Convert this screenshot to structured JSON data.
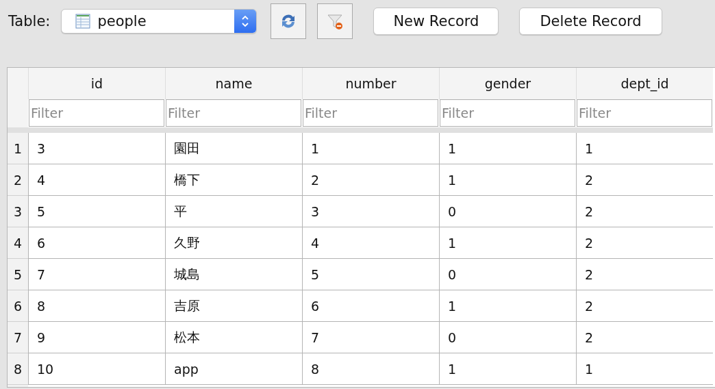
{
  "toolbar": {
    "label": "Table:",
    "table_select": {
      "value": "people"
    },
    "buttons": [
      "New Record",
      "Delete Record"
    ]
  },
  "table": {
    "columns": [
      {
        "header": "id",
        "filter_placeholder": "Filter"
      },
      {
        "header": "name",
        "filter_placeholder": "Filter"
      },
      {
        "header": "number",
        "filter_placeholder": "Filter"
      },
      {
        "header": "gender",
        "filter_placeholder": "Filter"
      },
      {
        "header": "dept_id",
        "filter_placeholder": "Filter"
      }
    ],
    "rows": [
      {
        "row_number": "1",
        "cells": [
          "3",
          "園田",
          "1",
          "1",
          "1"
        ]
      },
      {
        "row_number": "2",
        "cells": [
          "4",
          "橋下",
          "2",
          "1",
          "2"
        ]
      },
      {
        "row_number": "3",
        "cells": [
          "5",
          "平",
          "3",
          "0",
          "2"
        ]
      },
      {
        "row_number": "4",
        "cells": [
          "6",
          "久野",
          "4",
          "1",
          "2"
        ]
      },
      {
        "row_number": "5",
        "cells": [
          "7",
          "城島",
          "5",
          "0",
          "2"
        ]
      },
      {
        "row_number": "6",
        "cells": [
          "8",
          "吉原",
          "6",
          "1",
          "2"
        ]
      },
      {
        "row_number": "7",
        "cells": [
          "9",
          "松本",
          "7",
          "0",
          "2"
        ]
      },
      {
        "row_number": "8",
        "cells": [
          "10",
          "app",
          "8",
          "1",
          "1"
        ]
      }
    ]
  }
}
